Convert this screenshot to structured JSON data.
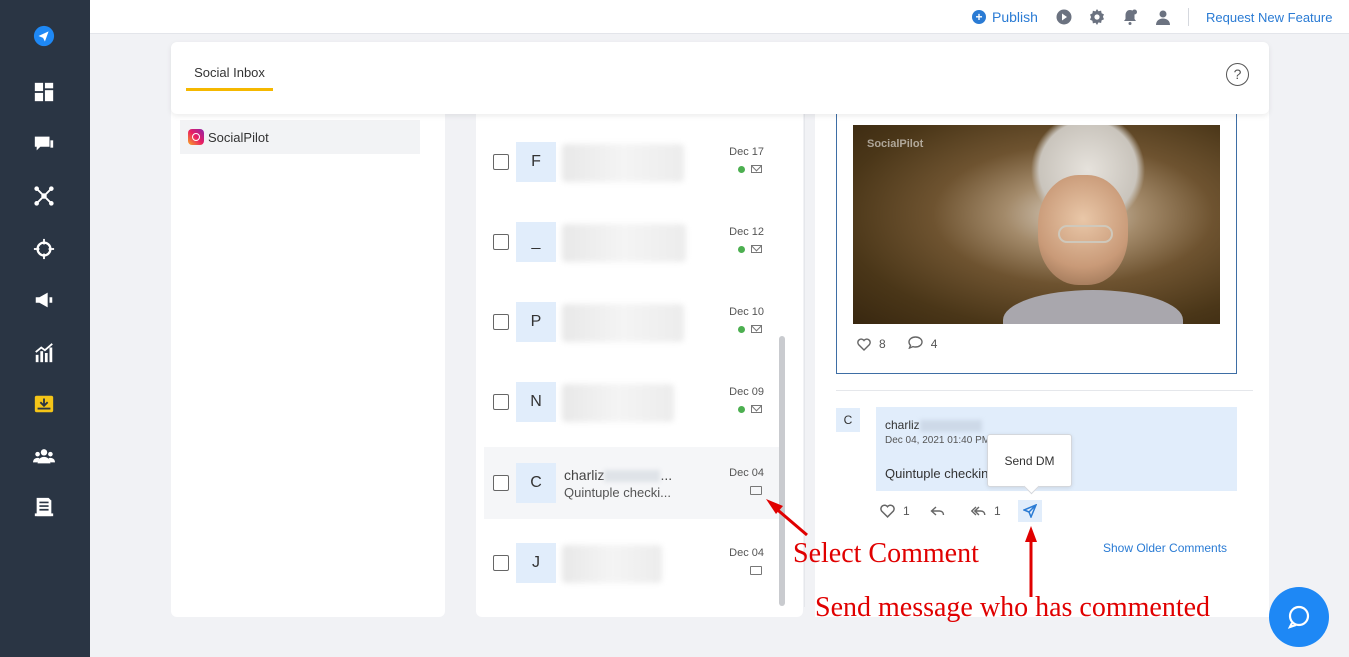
{
  "sidebar": {
    "items": [
      {
        "icon": "logo-plane-icon"
      },
      {
        "icon": "dashboard-icon"
      },
      {
        "icon": "posts-icon"
      },
      {
        "icon": "connections-icon"
      },
      {
        "icon": "target-icon"
      },
      {
        "icon": "megaphone-icon"
      },
      {
        "icon": "analytics-icon"
      },
      {
        "icon": "inbox-icon",
        "active": true
      },
      {
        "icon": "team-icon"
      },
      {
        "icon": "reports-icon"
      }
    ],
    "active_color": "#f5c518",
    "bg_color": "#2a3544"
  },
  "topbar": {
    "publish_label": "Publish",
    "request_label": "Request New Feature",
    "icons": [
      "play-icon",
      "gear-icon",
      "bell-icon",
      "user-icon"
    ]
  },
  "header": {
    "tab_label": "Social Inbox",
    "help_label": "?"
  },
  "accounts": {
    "items": [
      {
        "label": "SocialPilot",
        "network": "instagram"
      }
    ]
  },
  "conversations": [
    {
      "initial": "F",
      "date": "Dec 17",
      "type": "mail",
      "online": true
    },
    {
      "initial": "_",
      "date": "Dec 12",
      "type": "mail",
      "online": true
    },
    {
      "initial": "P",
      "date": "Dec 10",
      "type": "mail",
      "online": true
    },
    {
      "initial": "N",
      "date": "Dec 09",
      "type": "mail",
      "online": true
    },
    {
      "initial": "C",
      "name": "charliz",
      "name_suffix": "...",
      "preview": "Quintuple checki...",
      "date": "Dec 04",
      "type": "comment",
      "selected": true
    },
    {
      "initial": "J",
      "date": "Dec 04",
      "type": "comment"
    }
  ],
  "post": {
    "watermark": "SocialPilot",
    "likes": "8",
    "comments": "4"
  },
  "comment": {
    "initial": "C",
    "name": "charliz",
    "time": "Dec 04, 2021 01:40 PM",
    "text": "Quintuple checking",
    "likes": "1",
    "retweets": "1",
    "tooltip": "Send DM"
  },
  "show_older_label": "Show Older Comments",
  "annotations": {
    "select_comment": "Select Comment",
    "send_message": "Send message who has commented"
  }
}
